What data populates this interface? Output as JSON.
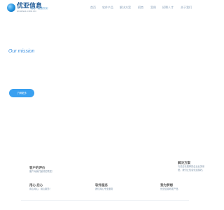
{
  "brand": {
    "name_cn": "优亚信息",
    "name_en": "UNIASIA.COM.CN",
    "slogan": "用心一起服务到"
  },
  "nav": {
    "items": [
      "首页",
      "软件产品",
      "解决方案",
      "招商",
      "案例",
      "招聘人才",
      "关于我们"
    ]
  },
  "hero": {
    "mission": "Our mission",
    "button_label": "了解更多"
  },
  "blocks": {
    "reviews": {
      "title": "客户的评价",
      "text": "客户对我们最好的赞赏！"
    },
    "solutions": {
      "title": "解决方案",
      "text": "与总店长推荐的企业业务系统，我们让信息化连接好。"
    },
    "heart": {
      "title": "用心 后心",
      "text": "用心用心，用心服务！"
    },
    "service": {
      "title": "软件服务",
      "text": "我们用心专业服务"
    },
    "values": {
      "title": "我为梦想",
      "text": "优亚信息研发产品"
    }
  }
}
